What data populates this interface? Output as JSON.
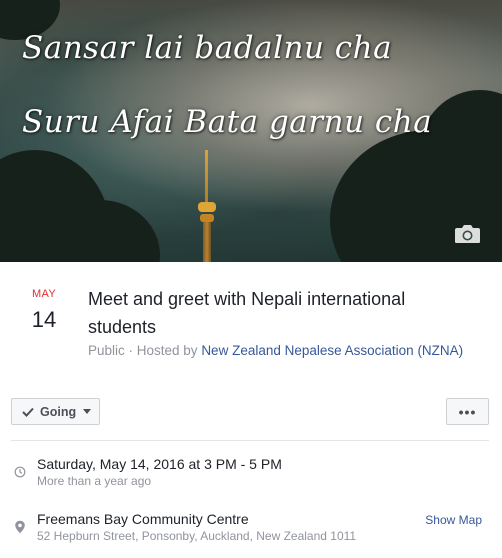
{
  "cover": {
    "line1": "Sansar lai badalnu cha",
    "line2": "Suru Afai Bata garnu cha",
    "camera_icon": "camera-icon"
  },
  "event": {
    "month": "MAY",
    "day": "14",
    "title": "Meet and greet with Nepali international students",
    "privacy_prefix": "Public · Hosted by ",
    "host": "New Zealand Nepalese Association (NZNA)"
  },
  "actions": {
    "going_label": "Going",
    "more_label": "•••"
  },
  "details": {
    "time_main": "Saturday, May 14, 2016 at 3 PM - 5 PM",
    "time_sub": "More than a year ago",
    "location_name": "Freemans Bay Community Centre",
    "location_address": "52 Hepburn Street, Ponsonby, Auckland, New Zealand 1011",
    "show_map_label": "Show Map",
    "icons": [
      "clock-icon",
      "map-pin-icon"
    ]
  },
  "colors": {
    "month": "#e02e2e",
    "link": "#365899",
    "muted": "#90949c"
  }
}
